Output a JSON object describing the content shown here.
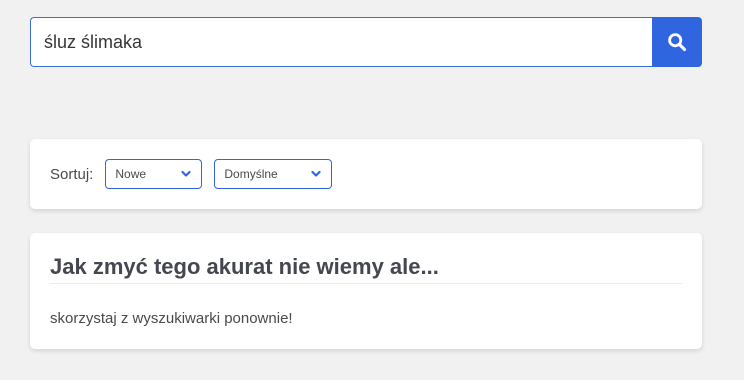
{
  "search": {
    "value": "śluz ślimaka",
    "icon": "search-icon",
    "button_color": "#2f66e0"
  },
  "sort": {
    "label": "Sortuj:",
    "selects": [
      {
        "selected": "Nowe",
        "icon": "chevron-down-icon"
      },
      {
        "selected": "Domyślne",
        "icon": "chevron-down-icon"
      }
    ]
  },
  "result": {
    "title": "Jak zmyć tego akurat nie wiemy ale...",
    "text": "skorzystaj z wyszukiwarki ponownie!"
  }
}
